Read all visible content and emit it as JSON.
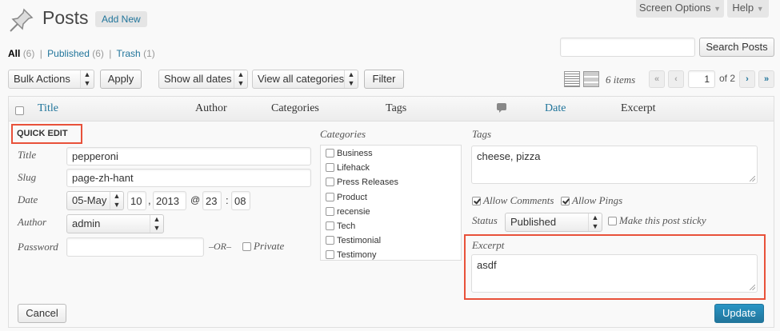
{
  "header": {
    "title": "Posts",
    "add_new": "Add New",
    "screen_options": "Screen Options",
    "help": "Help",
    "icon": "pushpin-icon"
  },
  "views": [
    {
      "label": "All",
      "count": "(6)"
    },
    {
      "label": "Published",
      "count": "(6)"
    },
    {
      "label": "Trash",
      "count": "(1)"
    }
  ],
  "search": {
    "button": "Search Posts",
    "value": ""
  },
  "toolbar": {
    "bulk_actions": "Bulk Actions",
    "apply": "Apply",
    "dates": "Show all dates",
    "categories": "View all categories",
    "filter": "Filter",
    "items_count": "6 items",
    "first": "«",
    "prev": "‹",
    "page": "1",
    "of_pages": "of 2",
    "next": "›",
    "last": "»"
  },
  "columns": {
    "title": "Title",
    "author": "Author",
    "categories": "Categories",
    "tags": "Tags",
    "comments_icon": "comment-bubble-icon",
    "date": "Date",
    "excerpt": "Excerpt"
  },
  "quick_edit": {
    "heading": "QUICK EDIT",
    "title_label": "Title",
    "title_value": "pepperoni",
    "slug_label": "Slug",
    "slug_value": "page-zh-hant",
    "date_label": "Date",
    "month": "05-May",
    "day": "10",
    "comma": ",",
    "year": "2013",
    "at": "@",
    "hour": "23",
    "colon": ":",
    "minute": "08",
    "author_label": "Author",
    "author_value": "admin",
    "password_label": "Password",
    "password_value": "",
    "or": "–OR–",
    "private_label": "Private",
    "categories_label": "Categories",
    "categories": [
      "Business",
      "Lifehack",
      "Press Releases",
      "Product",
      "recensie",
      "Tech",
      "Testimonial",
      "Testimony"
    ],
    "tags_label": "Tags",
    "tags_value": "cheese, pizza",
    "allow_comments": "Allow Comments",
    "allow_pings": "Allow Pings",
    "status_label": "Status",
    "status_value": "Published",
    "sticky_label": "Make this post sticky",
    "excerpt_label": "Excerpt",
    "excerpt_value": "asdf",
    "cancel": "Cancel",
    "update": "Update"
  },
  "colors": {
    "link": "#21759b",
    "highlight_border": "#e8513a",
    "primary_button": "#2a95c5"
  }
}
